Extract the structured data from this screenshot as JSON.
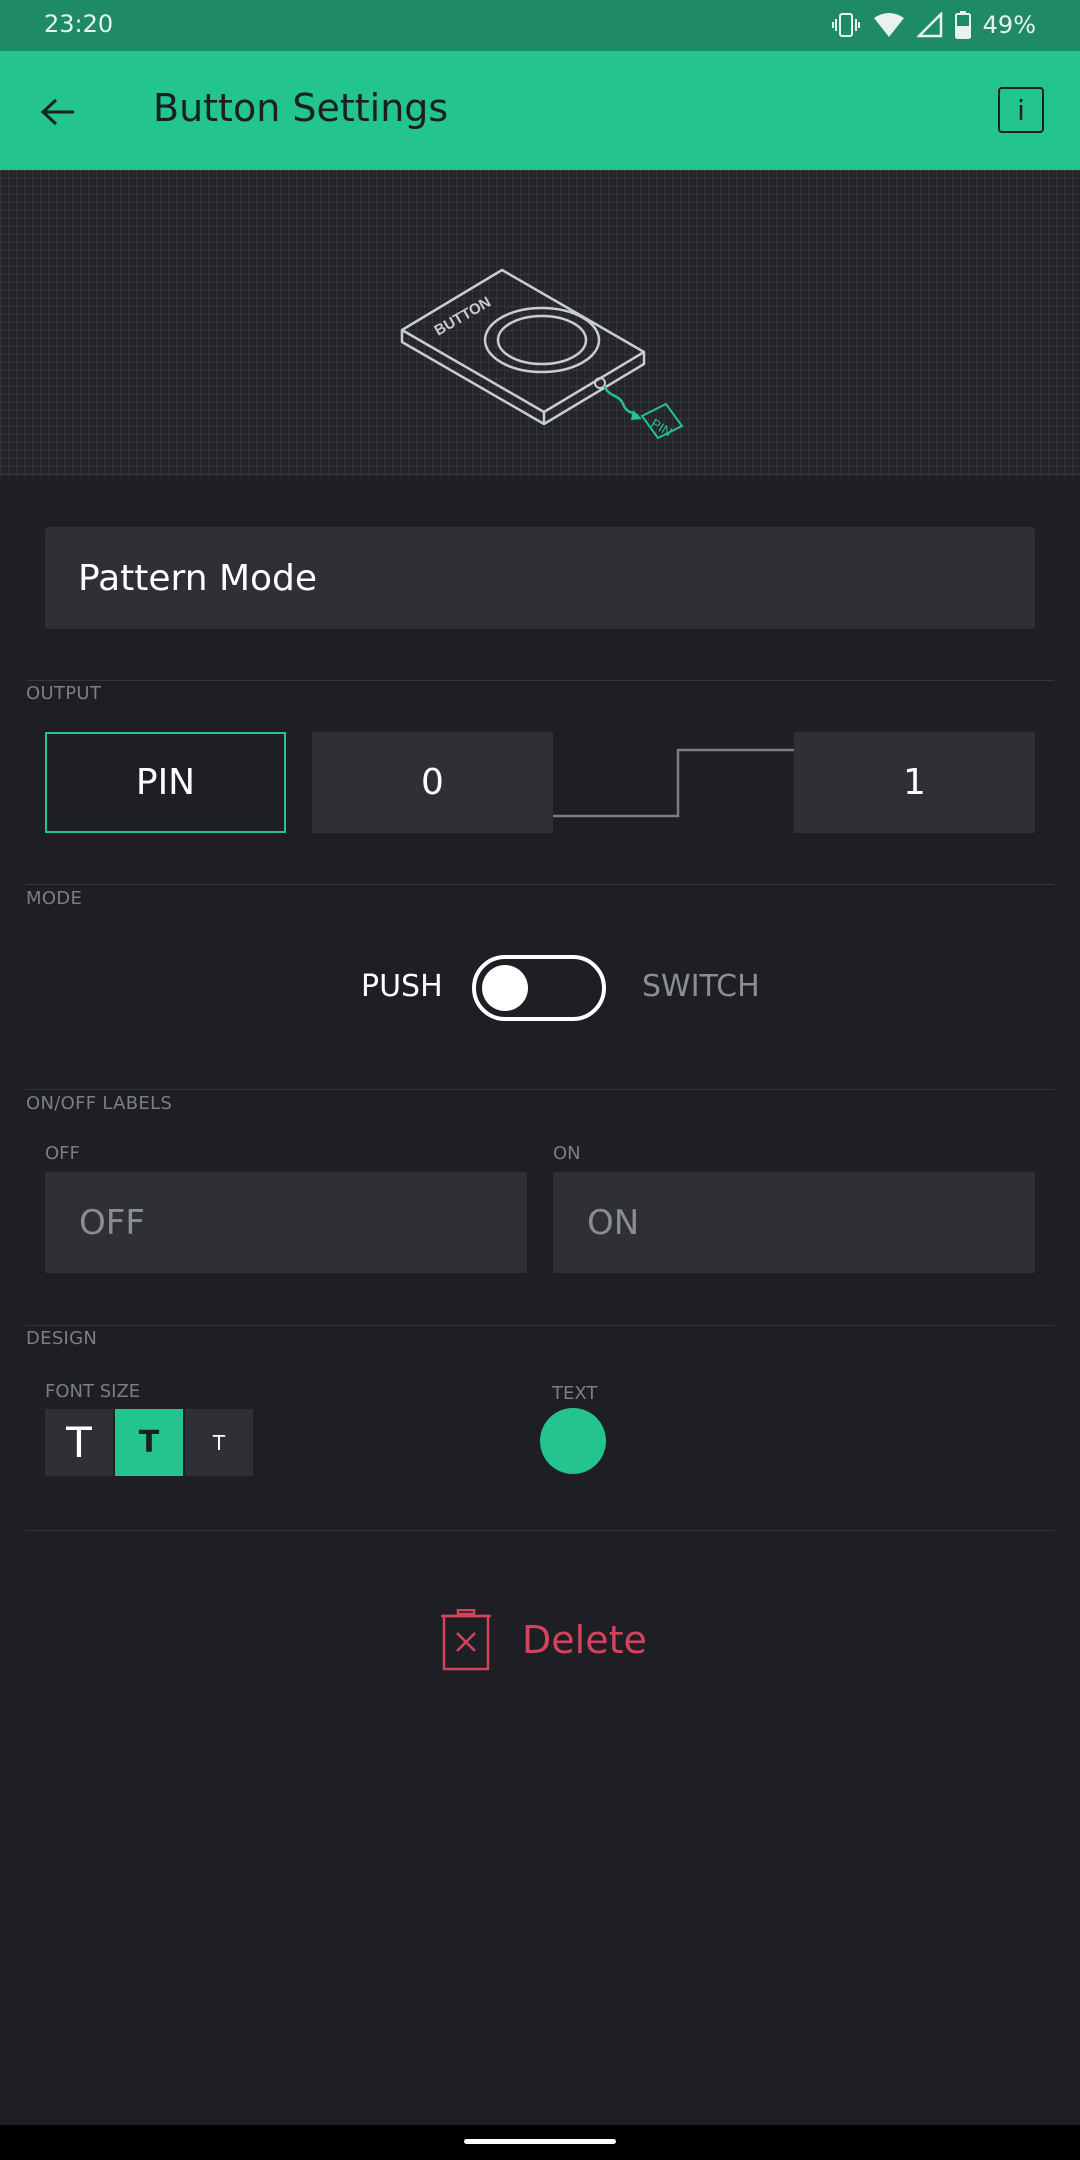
{
  "status_bar": {
    "time": "23:20",
    "battery": "49%",
    "icons": [
      "vibrate-icon",
      "wifi-icon",
      "signal-icon",
      "battery-icon"
    ]
  },
  "app_bar": {
    "title": "Button Settings",
    "back_icon": "arrow-left-icon",
    "info_label": "i"
  },
  "hero": {
    "button_text": "BUTTON",
    "pin_text": "PIN"
  },
  "name_field": {
    "value": "Pattern Mode"
  },
  "output": {
    "section_label": "OUTPUT",
    "pin_label": "PIN",
    "low_value": "0",
    "high_value": "1"
  },
  "mode": {
    "section_label": "MODE",
    "push_label": "PUSH",
    "switch_label": "SWITCH",
    "selected": "PUSH"
  },
  "labels": {
    "section_label": "ON/OFF LABELS",
    "off_caption": "OFF",
    "on_caption": "ON",
    "off_placeholder": "OFF",
    "on_placeholder": "ON"
  },
  "design": {
    "section_label": "DESIGN",
    "font_size_label": "FONT SIZE",
    "font_sizes": [
      "T",
      "T",
      "T"
    ],
    "selected_font_index": 1,
    "text_label": "TEXT",
    "text_color": "#23c48e"
  },
  "actions": {
    "delete_label": "Delete"
  },
  "colors": {
    "accent": "#23c48e",
    "danger": "#d3435c",
    "background": "#1d1f24"
  }
}
